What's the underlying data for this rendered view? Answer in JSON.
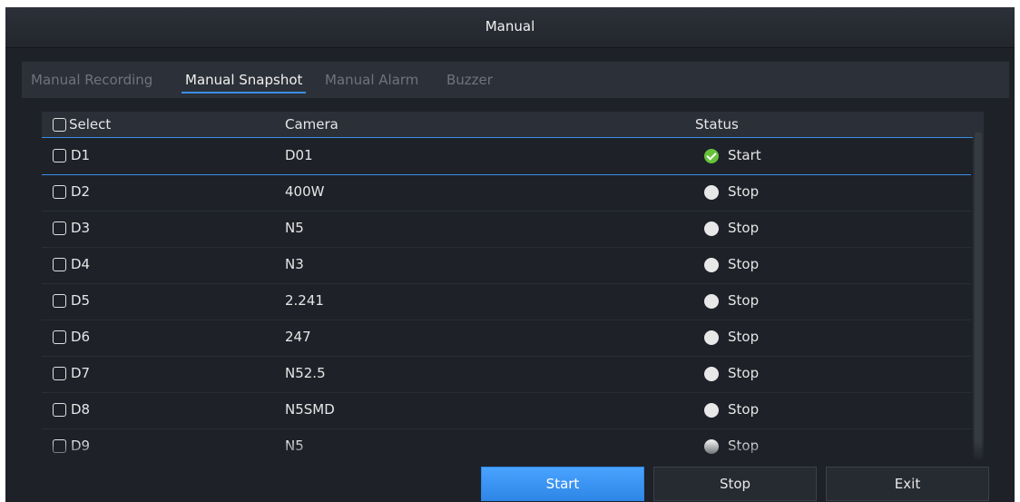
{
  "window": {
    "title": "Manual"
  },
  "tabs": [
    {
      "label": "Manual Recording",
      "active": false
    },
    {
      "label": "Manual Snapshot",
      "active": true
    },
    {
      "label": "Manual Alarm",
      "active": false
    },
    {
      "label": "Buzzer",
      "active": false
    }
  ],
  "table": {
    "headers": {
      "select": "Select",
      "camera": "Camera",
      "status": "Status"
    },
    "rows": [
      {
        "id": "D1",
        "camera": "D01",
        "status": "Start",
        "active": true
      },
      {
        "id": "D2",
        "camera": "400W",
        "status": "Stop",
        "active": false
      },
      {
        "id": "D3",
        "camera": "N5",
        "status": "Stop",
        "active": false
      },
      {
        "id": "D4",
        "camera": "N3",
        "status": "Stop",
        "active": false
      },
      {
        "id": "D5",
        "camera": "2.241",
        "status": "Stop",
        "active": false
      },
      {
        "id": "D6",
        "camera": "247",
        "status": "Stop",
        "active": false
      },
      {
        "id": "D7",
        "camera": "N52.5",
        "status": "Stop",
        "active": false
      },
      {
        "id": "D8",
        "camera": "N5SMD",
        "status": "Stop",
        "active": false
      },
      {
        "id": "D9",
        "camera": "N5",
        "status": "Stop",
        "active": false
      }
    ]
  },
  "buttons": {
    "start": "Start",
    "stop": "Stop",
    "exit": "Exit"
  },
  "colors": {
    "accent": "#3a8ee6",
    "ok": "#67c23a",
    "background": "#1e2128"
  }
}
